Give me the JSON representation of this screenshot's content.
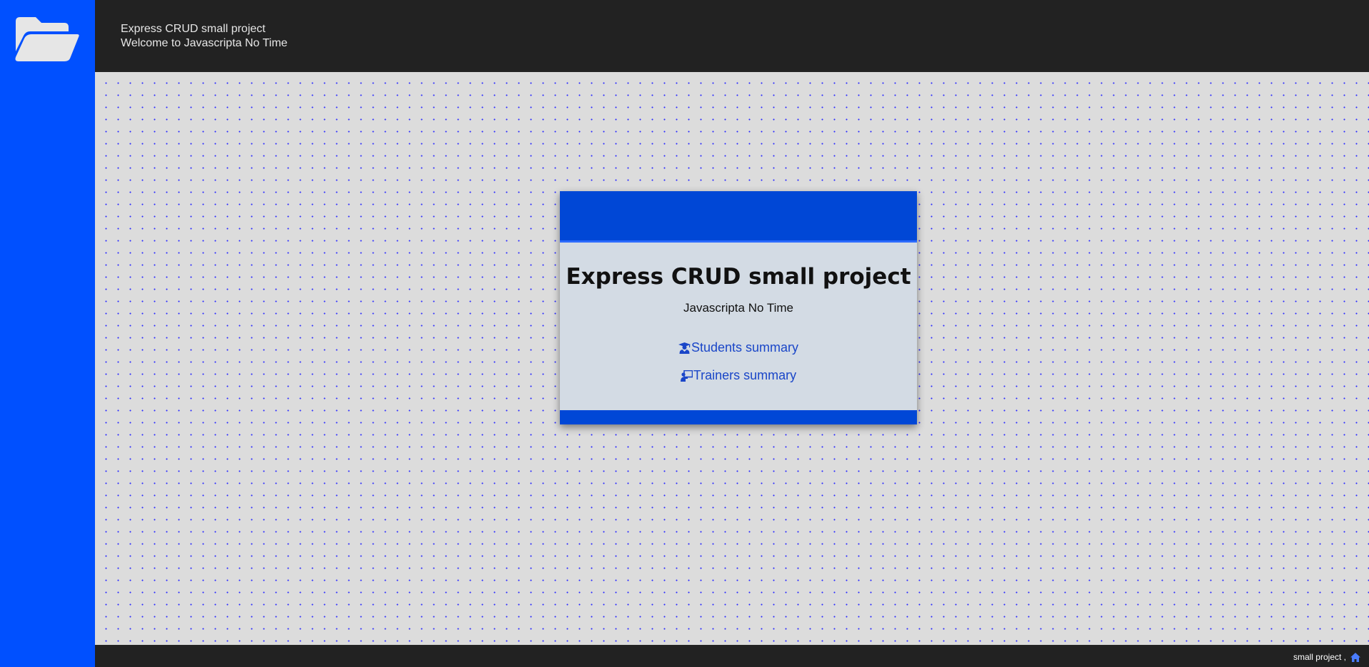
{
  "sidebar": {
    "logo_icon": "folder-open-icon"
  },
  "header": {
    "title": "Express CRUD small project",
    "subtitle": "Welcome to Javascripta No Time"
  },
  "card": {
    "title": "Express CRUD small project",
    "subtitle": "Javascripta No Time",
    "links": [
      {
        "label": "Students summary",
        "icon": "user-graduate-icon"
      },
      {
        "label": "Trainers summary",
        "icon": "chalkboard-teacher-icon"
      }
    ]
  },
  "footer": {
    "text": "small project ,",
    "icon": "home-icon"
  },
  "colors": {
    "sidebar": "#0050ff",
    "header": "#222222",
    "card_band": "#0047d6",
    "link": "#1a46c8",
    "card_body": "#d3dbe4"
  }
}
